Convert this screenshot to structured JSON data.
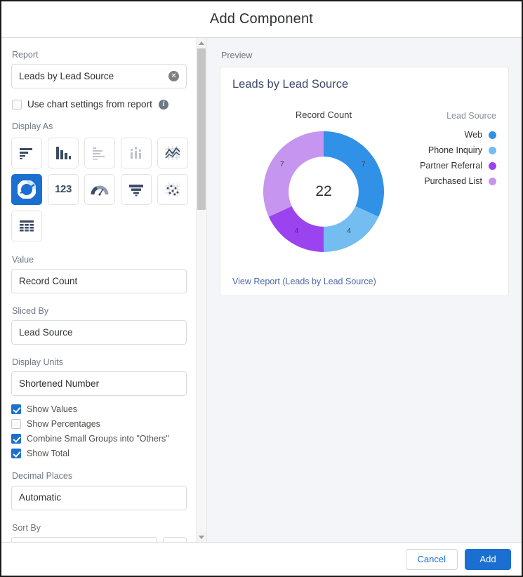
{
  "modal": {
    "title": "Add Component",
    "cancel_label": "Cancel",
    "add_label": "Add"
  },
  "sidebar": {
    "report": {
      "label": "Report",
      "value": "Leads by Lead Source",
      "clear_icon": "clear-circle-icon"
    },
    "use_chart_settings": {
      "label": "Use chart settings from report",
      "checked": false,
      "info_icon": "info-icon",
      "info_glyph": "i"
    },
    "display_as": {
      "label": "Display As",
      "options": [
        {
          "name": "horizontal-bar-chart",
          "selected": false
        },
        {
          "name": "vertical-bar-chart",
          "selected": false
        },
        {
          "name": "stacked-horizontal-bar-chart",
          "selected": false
        },
        {
          "name": "stacked-vertical-bar-chart",
          "selected": false
        },
        {
          "name": "line-chart",
          "selected": false
        },
        {
          "name": "donut-chart",
          "selected": true
        },
        {
          "name": "metric-number",
          "selected": false,
          "glyph": "123"
        },
        {
          "name": "gauge-chart",
          "selected": false
        },
        {
          "name": "funnel-chart",
          "selected": false
        },
        {
          "name": "scatter-chart",
          "selected": false
        },
        {
          "name": "table-chart",
          "selected": false
        }
      ]
    },
    "value": {
      "label": "Value",
      "value": "Record Count"
    },
    "sliced_by": {
      "label": "Sliced By",
      "value": "Lead Source"
    },
    "display_units": {
      "label": "Display Units",
      "value": "Shortened Number"
    },
    "toggles": [
      {
        "label": "Show Values",
        "checked": true
      },
      {
        "label": "Show Percentages",
        "checked": false
      },
      {
        "label": "Combine Small Groups into \"Others\"",
        "checked": true
      },
      {
        "label": "Show Total",
        "checked": true
      }
    ],
    "decimal_places": {
      "label": "Decimal Places",
      "value": "Automatic"
    },
    "sort_by": {
      "label": "Sort By",
      "value": ""
    }
  },
  "preview": {
    "label": "Preview",
    "card_title": "Leads by Lead Source",
    "view_report_link": "View Report (Leads by Lead Source)"
  },
  "chart_data": {
    "type": "pie",
    "title": "Leads by Lead Source",
    "measure_title": "Record Count",
    "legend_title": "Lead Source",
    "legend_position": "right",
    "total": "22",
    "total_value": 22,
    "categories": [
      "Web",
      "Phone Inquiry",
      "Partner Referral",
      "Purchased List"
    ],
    "values": [
      7,
      4,
      4,
      7
    ],
    "labels": [
      "7",
      "4",
      "4",
      "7"
    ],
    "colors": [
      "#3191e6",
      "#73bdf0",
      "#9b43ef",
      "#c595ef"
    ],
    "donut": true,
    "inner_radius_ratio": 0.58,
    "start_angle_deg": 0
  },
  "theme": {
    "brand_blue": "#1b6fd0",
    "panel_bg": "#f3f5f8",
    "text_dark": "#2f3032",
    "text_muted": "#6f7782"
  }
}
